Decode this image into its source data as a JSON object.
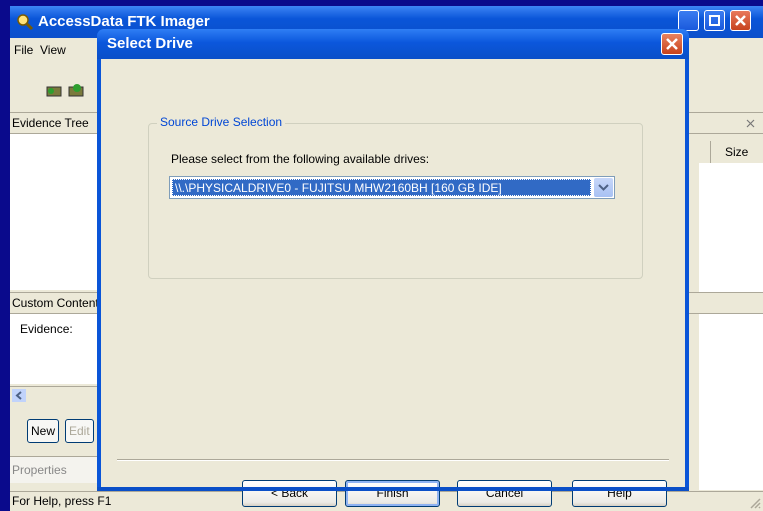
{
  "app": {
    "title": "AccessData FTK Imager",
    "menu": [
      "File",
      "View"
    ],
    "panels": {
      "evidence_tree": "Evidence Tree",
      "custom_content": "Custom Content",
      "evidence_col": "Evidence:",
      "properties": "Properties"
    },
    "file_list": {
      "size_header": "Size"
    },
    "buttons": {
      "new": "New",
      "edit": "Edit"
    },
    "status": "For Help, press F1"
  },
  "dialog": {
    "title": "Select Drive",
    "group_label": "Source Drive Selection",
    "prompt": "Please select from the following available drives:",
    "drive_select": {
      "value": "\\\\.\\PHYSICALDRIVE0 - FUJITSU MHW2160BH [160 GB IDE]"
    },
    "buttons": {
      "back": "< Back",
      "finish": "Finish",
      "cancel": "Cancel",
      "help": "Help"
    }
  },
  "colors": {
    "desktop": "#0a0a8c",
    "titlebar": "#0a55d8",
    "dialog_face": "#ece9d8",
    "selection": "#316ac5",
    "group_label": "#0046d5"
  }
}
